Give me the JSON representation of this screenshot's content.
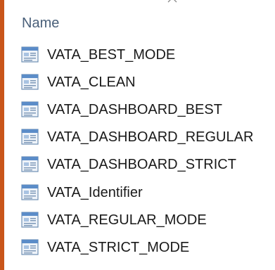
{
  "column": {
    "label": "Name",
    "sort_icon": "chevron-up-icon"
  },
  "files": [
    {
      "name": "VATA_BEST_MODE",
      "icon": "document-icon"
    },
    {
      "name": "VATA_CLEAN",
      "icon": "document-icon"
    },
    {
      "name": "VATA_DASHBOARD_BEST",
      "icon": "document-icon"
    },
    {
      "name": "VATA_DASHBOARD_REGULAR",
      "icon": "document-icon"
    },
    {
      "name": "VATA_DASHBOARD_STRICT",
      "icon": "document-icon"
    },
    {
      "name": "VATA_Identifier",
      "icon": "document-icon"
    },
    {
      "name": "VATA_REGULAR_MODE",
      "icon": "document-icon"
    },
    {
      "name": "VATA_STRICT_MODE",
      "icon": "document-icon"
    }
  ],
  "colors": {
    "accent_edge": "#c9551a",
    "header_text": "#4a607a",
    "item_text": "#1a1a1a"
  }
}
